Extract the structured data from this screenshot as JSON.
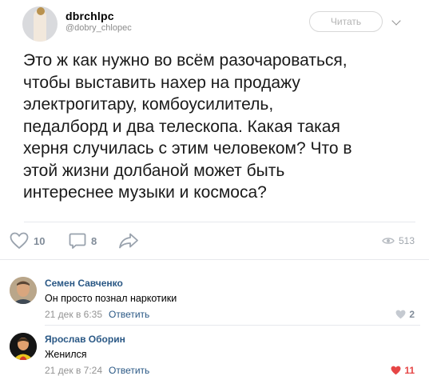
{
  "tweet": {
    "display_name": "dbrchlpc",
    "handle": "@dobry_chlopec",
    "follow_label": "Читать",
    "text_lines": [
      "Это ж как нужно во всём разочароваться,",
      "чтобы выставить нахер на продажу",
      "электрогитару, комбоусилитель,",
      "педалборд и два телескопа. Какая такая",
      "херня случилась с этим человеком? Что в",
      "этой жизни долбаной может быть",
      "интереснее музыки и космоса?"
    ]
  },
  "actions": {
    "likes": "10",
    "comments": "8",
    "views": "513"
  },
  "comments": [
    {
      "author": "Семен Савченко",
      "text": "Он просто познал наркотики",
      "date": "21 дек в 6:35",
      "reply_label": "Ответить",
      "likes": "2",
      "liked": false
    },
    {
      "author": "Ярослав Оборин",
      "text": "Женился",
      "date": "21 дек в 7:24",
      "reply_label": "Ответить",
      "likes": "11",
      "liked": true
    }
  ],
  "colors": {
    "link": "#2a5885",
    "meta": "#939393",
    "icon": "#818c99",
    "liked": "#e64646"
  }
}
